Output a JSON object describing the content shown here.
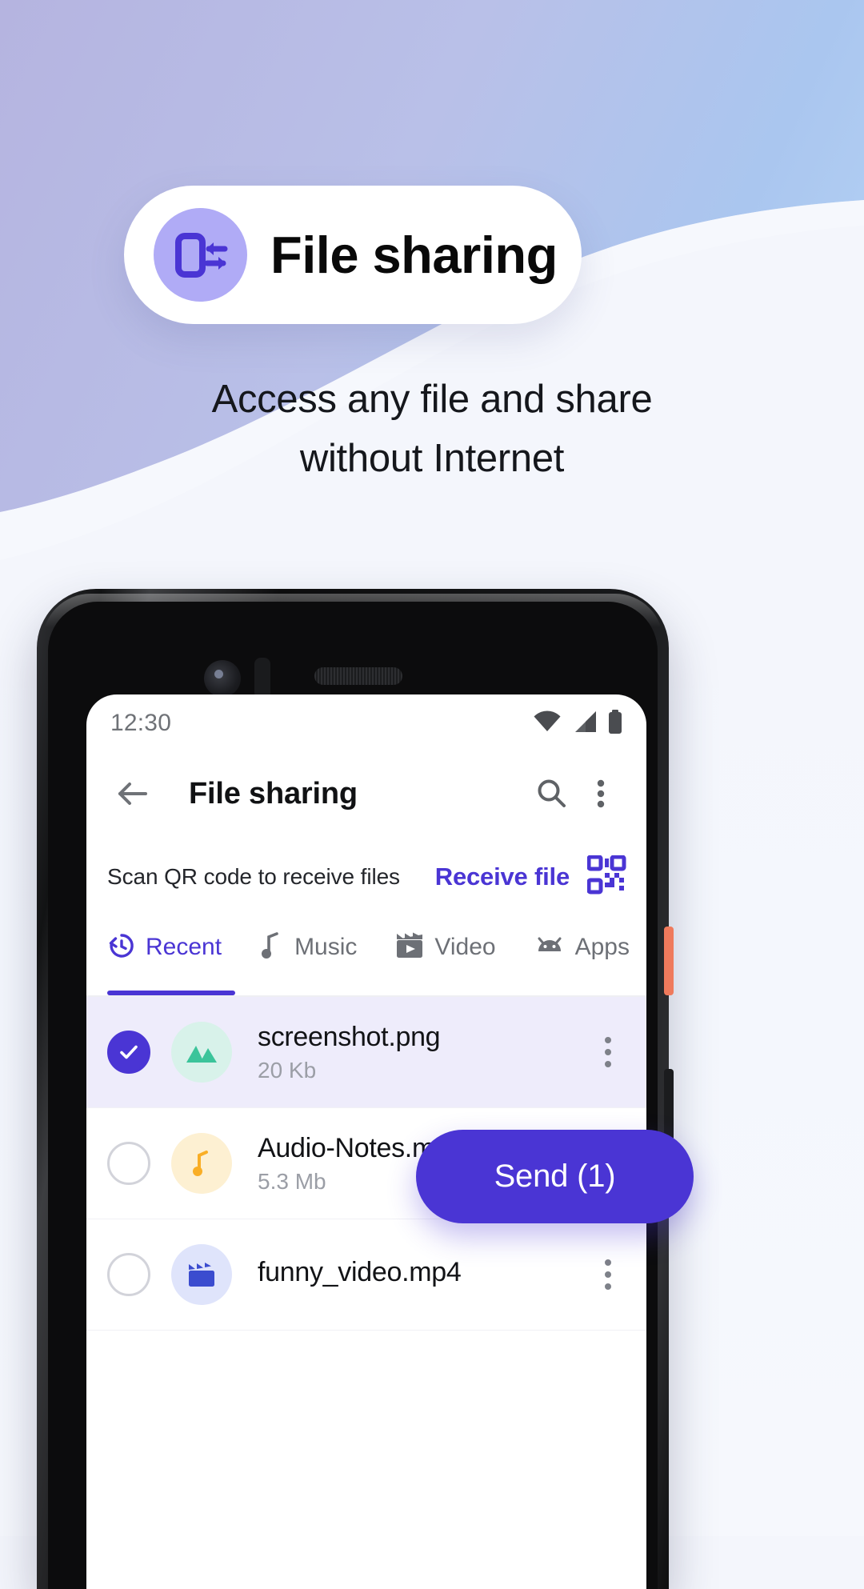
{
  "promo": {
    "badge": {
      "icon": "phone-transfer-icon",
      "title": "File sharing",
      "icon_bg": "#b0abf6",
      "icon_color": "#4a35d4"
    },
    "subtitle_line1": "Access any file and share",
    "subtitle_line2": "without Internet",
    "bg_gradient_from": "#b5b4e0",
    "bg_gradient_to": "#b9d7f7",
    "bg_lower": "#f4f6fc"
  },
  "phone": {
    "status_bar": {
      "time": "12:30",
      "icons": [
        "wifi-icon",
        "cellular-signal-icon",
        "battery-icon"
      ]
    },
    "app_bar": {
      "back_icon": "arrow-left-icon",
      "title": "File sharing",
      "search_icon": "search-icon",
      "overflow_icon": "more-vertical-icon"
    },
    "qr_row": {
      "hint": "Scan QR code to receive files",
      "receive_label": "Receive file",
      "qr_icon": "qr-code-icon",
      "accent": "#4a35d4"
    },
    "tabs": {
      "active_index": 0,
      "items": [
        {
          "label": "Recent",
          "icon": "history-clock-icon"
        },
        {
          "label": "Music",
          "icon": "music-note-icon"
        },
        {
          "label": "Video",
          "icon": "clapperboard-icon"
        },
        {
          "label": "Apps",
          "icon": "android-icon"
        },
        {
          "label": "",
          "icon": "image-mountain-icon"
        }
      ]
    },
    "files": [
      {
        "name": "screenshot.png",
        "size": "20 Kb",
        "selected": true,
        "thumb_icon": "image-mountain-icon",
        "thumb_bg": "#d8f2ea",
        "thumb_color": "#3bc49a",
        "menu_icon": "more-vertical-icon"
      },
      {
        "name": "Audio-Notes.mp3",
        "size": "5.3 Mb",
        "selected": false,
        "thumb_icon": "music-note-icon",
        "thumb_bg": "#fdf0d2",
        "thumb_color": "#f9ae26",
        "menu_icon": "more-vertical-icon"
      },
      {
        "name": "funny_video.mp4",
        "size": "",
        "selected": false,
        "thumb_icon": "clapperboard-icon",
        "thumb_bg": "#dfe4fb",
        "thumb_color": "#3b4ccf",
        "menu_icon": "more-vertical-icon"
      }
    ],
    "send_button": {
      "label": "Send (1)",
      "color": "#4a35d4"
    }
  }
}
